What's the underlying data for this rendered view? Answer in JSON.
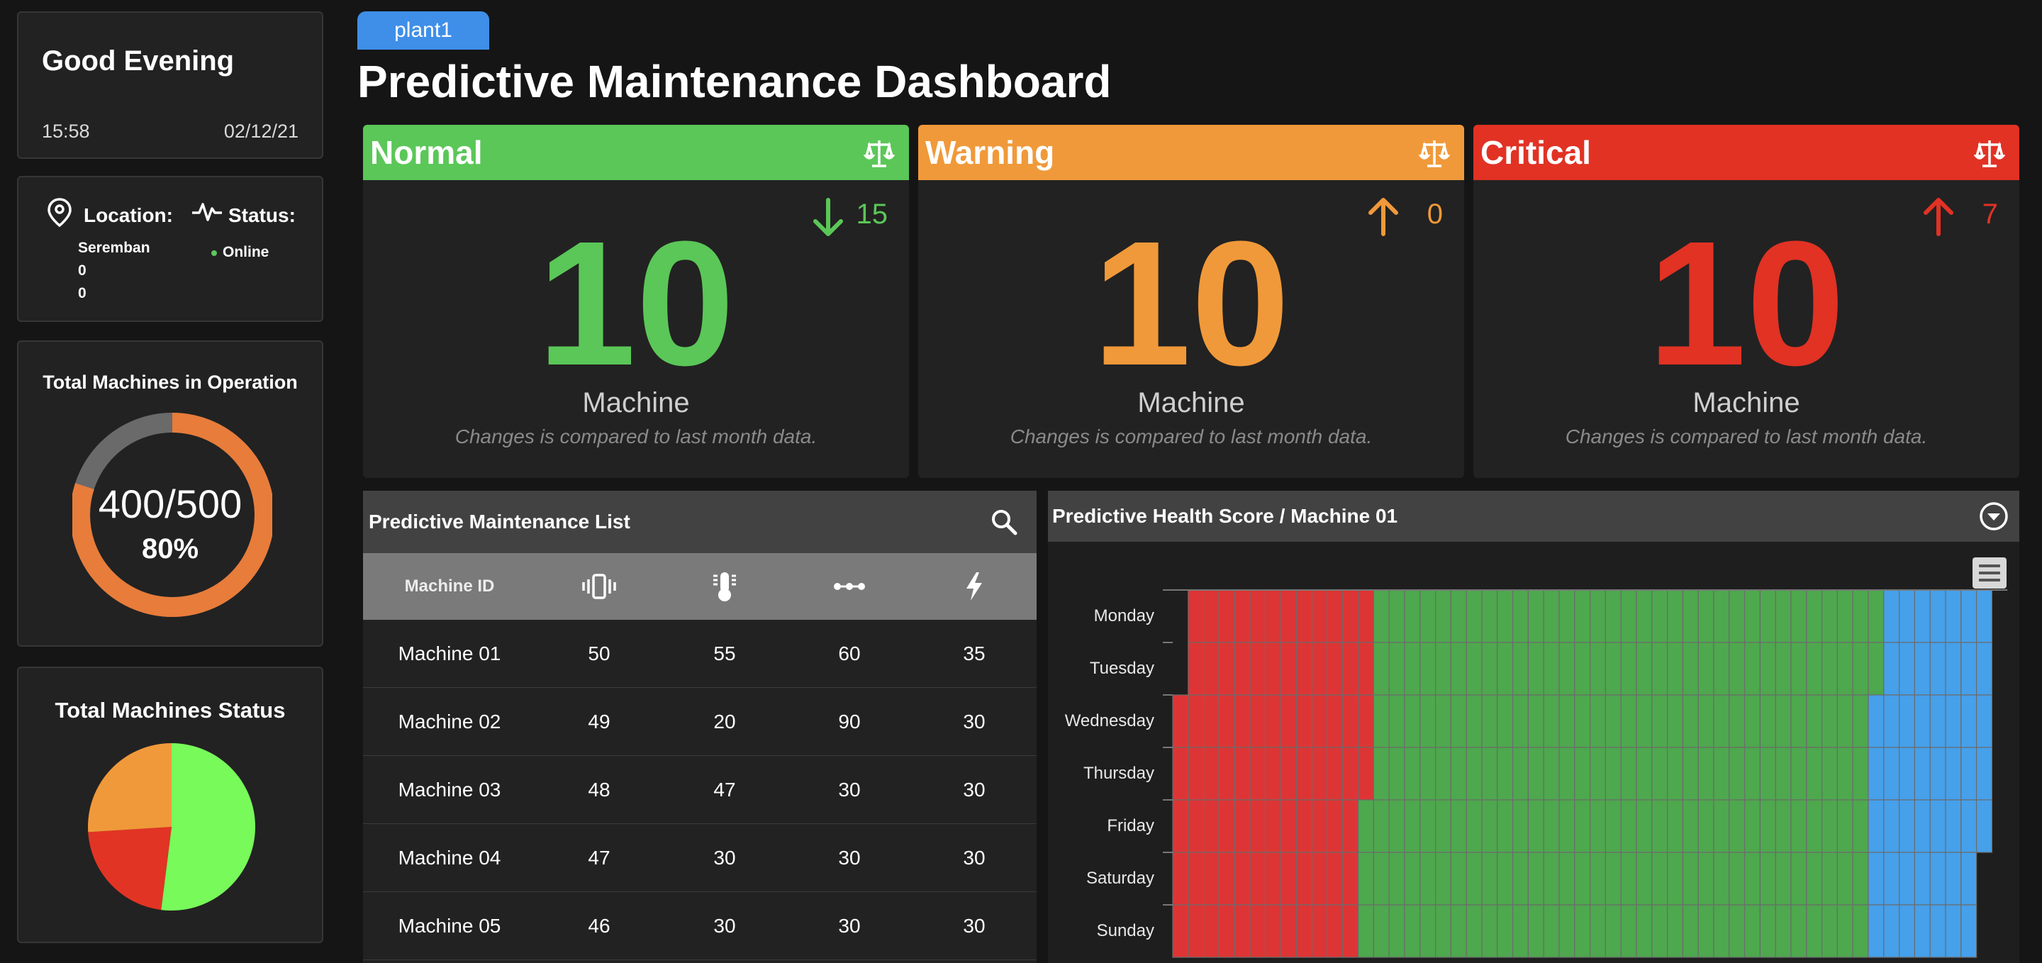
{
  "greeting": {
    "title": "Good Evening",
    "time": "15:58",
    "date": "02/12/21"
  },
  "location": {
    "location_label": "Location:",
    "status_label": "Status:",
    "city": "Seremban",
    "lat": "0",
    "lng": "0",
    "status": "Online",
    "status_color": "#5cc85c"
  },
  "operation": {
    "title": "Total Machines in Operation",
    "count": "400/500",
    "percent": "80%",
    "fraction": 0.8,
    "colors": {
      "active": "#e87c3a",
      "rest": "#6a6a6a"
    }
  },
  "machine_status": {
    "title": "Total Machines Status",
    "slices": [
      {
        "name": "Normal",
        "value": 52,
        "color": "#77fa5a"
      },
      {
        "name": "Critical",
        "value": 22,
        "color": "#e23424"
      },
      {
        "name": "Warning",
        "value": 26,
        "color": "#f0993a"
      }
    ]
  },
  "header": {
    "tab": "plant1",
    "title": "Predictive Maintenance Dashboard"
  },
  "kpis": [
    {
      "name": "Normal",
      "value": "10",
      "unit": "Machine",
      "delta": "15",
      "direction": "down",
      "note": "Changes is compared to last month data.",
      "color": "#5bc758",
      "icon": "balance-scale-icon"
    },
    {
      "name": "Warning",
      "value": "10",
      "unit": "Machine",
      "delta": "0",
      "direction": "up",
      "note": "Changes is compared to last month data.",
      "color": "#f0993a",
      "icon": "balance-scale-icon"
    },
    {
      "name": "Critical",
      "value": "10",
      "unit": "Machine",
      "delta": "7",
      "direction": "up",
      "note": "Changes is compared to last month data.",
      "color": "#e13224",
      "icon": "balance-scale-icon"
    }
  ],
  "maintenance_list": {
    "title": "Predictive Maintenance List",
    "columns": [
      "Machine ID",
      "vibration-icon",
      "temperature-icon",
      "pressure-icon",
      "power-icon"
    ],
    "rows": [
      [
        "Machine 01",
        "50",
        "55",
        "60",
        "35"
      ],
      [
        "Machine 02",
        "49",
        "20",
        "90",
        "30"
      ],
      [
        "Machine 03",
        "48",
        "47",
        "30",
        "30"
      ],
      [
        "Machine 04",
        "47",
        "30",
        "30",
        "30"
      ],
      [
        "Machine 05",
        "46",
        "30",
        "30",
        "30"
      ]
    ]
  },
  "health": {
    "title": "Predictive Health Score / Machine 01",
    "days": [
      "Monday",
      "Tuesday",
      "Wednesday",
      "Thursday",
      "Friday",
      "Saturday",
      "Sunday"
    ],
    "colors": {
      "critical": "#dd3535",
      "normal": "#4ea84e",
      "warning": "#46a0ea"
    },
    "rows": [
      {
        "start": 1,
        "critical_end": 13,
        "normal_end": 46,
        "end": 53
      },
      {
        "start": 1,
        "critical_end": 13,
        "normal_end": 46,
        "end": 53
      },
      {
        "start": 0,
        "critical_end": 13,
        "normal_end": 45,
        "end": 53
      },
      {
        "start": 0,
        "critical_end": 13,
        "normal_end": 45,
        "end": 53
      },
      {
        "start": 0,
        "critical_end": 12,
        "normal_end": 45,
        "end": 53
      },
      {
        "start": 0,
        "critical_end": 12,
        "normal_end": 45,
        "end": 52
      },
      {
        "start": 0,
        "critical_end": 12,
        "normal_end": 45,
        "end": 52
      }
    ],
    "max_cells": 54
  }
}
